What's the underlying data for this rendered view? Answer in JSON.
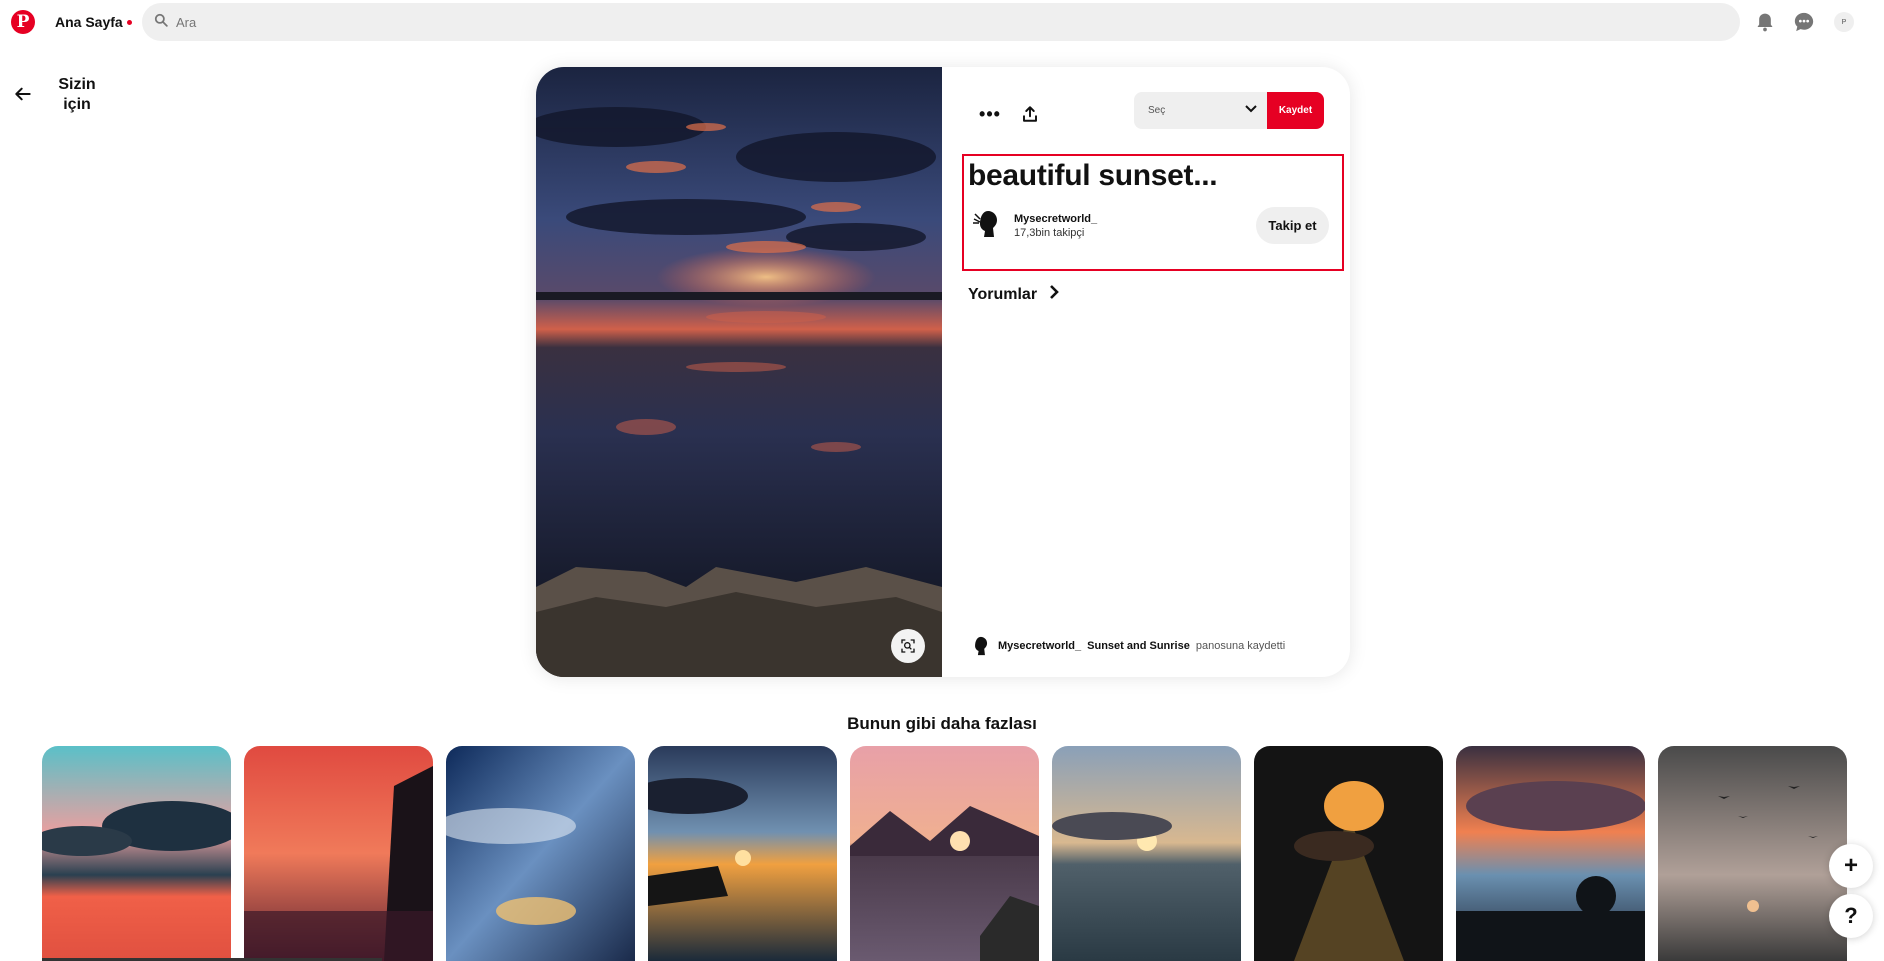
{
  "header": {
    "home_label": "Ana Sayfa",
    "search_placeholder": "Ara",
    "avatar_initial": "P",
    "icons": [
      "pinterest-logo-icon",
      "search-icon",
      "bell-icon",
      "chat-icon"
    ]
  },
  "back": {
    "label": "Sizin için"
  },
  "pin": {
    "title": "beautiful sunset...",
    "board_select_placeholder": "Seç",
    "save_label": "Kaydet",
    "author": {
      "name": "Mysecretworld_",
      "followers": "17,3bin takipçi",
      "follow_label": "Takip et"
    },
    "comments_label": "Yorumlar",
    "saved_by": {
      "user": "Mysecretworld_",
      "board": "Sunset and Sunrise",
      "suffix": "panosuna kaydetti"
    }
  },
  "related": {
    "title": "Bunun gibi daha fazlası",
    "items": [
      "sunset-1",
      "sunset-2",
      "sunset-3",
      "sunset-4",
      "sunset-5",
      "sunset-6",
      "sunset-7",
      "sunset-8",
      "sunset-9"
    ]
  },
  "floating": {
    "add": "+",
    "help": "?"
  },
  "colors": {
    "brand": "#e60023",
    "surface": "#efefef"
  }
}
